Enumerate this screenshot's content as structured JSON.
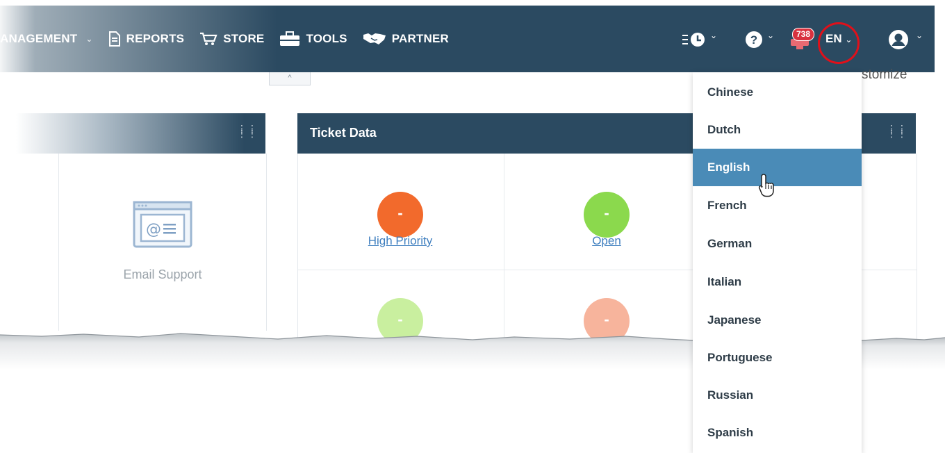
{
  "nav": {
    "management": "ANAGEMENT",
    "reports": "REPORTS",
    "store": "STORE",
    "tools": "TOOLS",
    "partner": "PARTNER"
  },
  "toolbar": {
    "notifications_count": "738",
    "language_code": "EN"
  },
  "customize_fragment": "stomize",
  "left_panel": {
    "email_label": "Email Support"
  },
  "ticket_panel": {
    "title": "Ticket Data",
    "items": [
      {
        "value": "-",
        "label": "High Priority",
        "color": "#f26a2c"
      },
      {
        "value": "-",
        "label": "Open",
        "color": "#8bd94d"
      },
      {
        "value": "-",
        "label": "",
        "color": "#c9ef9f"
      },
      {
        "value": "-",
        "label": "",
        "color": "#f7b49c"
      }
    ]
  },
  "language_menu": {
    "selected": "English",
    "options": [
      "Chinese",
      "Dutch",
      "English",
      "French",
      "German",
      "Italian",
      "Japanese",
      "Portuguese",
      "Russian",
      "Spanish"
    ]
  },
  "colors": {
    "topbar": "#2b4a61",
    "menu_highlight": "#4a8bb7",
    "annotation_circle": "#e0101a",
    "link": "#3f7fbf"
  }
}
